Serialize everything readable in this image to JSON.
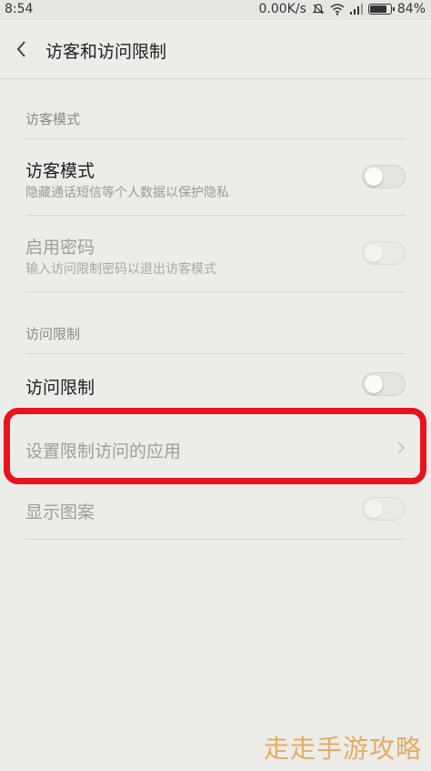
{
  "status_bar": {
    "time": "8:54",
    "network_speed": "0.00K/s",
    "battery_percent": "84%",
    "battery_level": 0.84,
    "icons": [
      "mute-bell-icon",
      "wifi-icon",
      "signal-icon",
      "battery-icon"
    ]
  },
  "header": {
    "title": "访客和访问限制",
    "back_icon": "back-arrow-icon"
  },
  "sections": {
    "guest": {
      "label": "访客模式",
      "items": [
        {
          "title": "访客模式",
          "subtitle": "隐藏通话短信等个人数据以保护隐私",
          "toggle_on": false,
          "enabled": true
        },
        {
          "title": "启用密码",
          "subtitle": "输入访问限制密码以退出访客模式",
          "toggle_on": false,
          "enabled": false
        }
      ]
    },
    "access": {
      "label": "访问限制",
      "items": [
        {
          "title": "访问限制",
          "toggle_on": false,
          "enabled": true
        },
        {
          "title": "设置限制访问的应用",
          "enabled": false,
          "chevron_icon": "chevron-right-icon"
        },
        {
          "title": "显示图案",
          "toggle_on": false,
          "enabled": false
        }
      ]
    }
  },
  "annotation": {
    "highlight_color": "#e8141c"
  },
  "watermark": "走走手游攻略"
}
